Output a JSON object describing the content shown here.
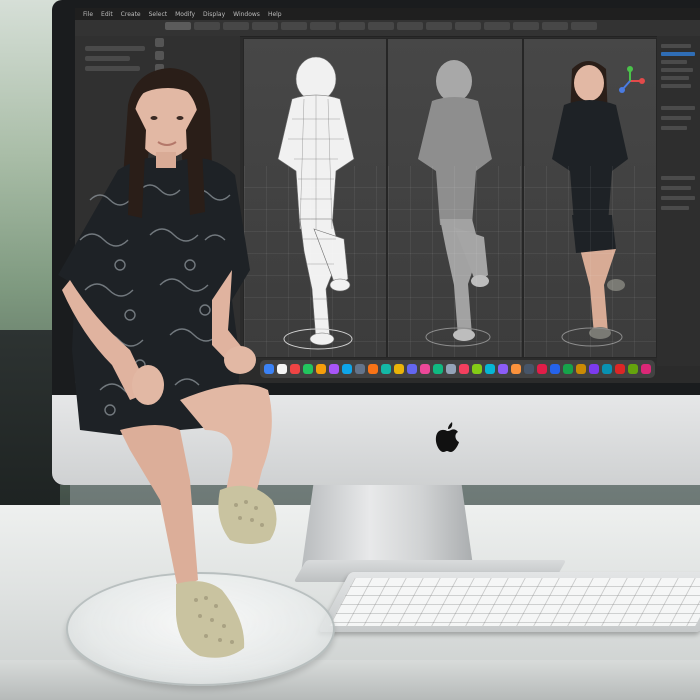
{
  "scene": {
    "description_elements": [
      "monitor",
      "screen",
      "keyboard",
      "figurine",
      "acrylic-base",
      "desk"
    ]
  },
  "screen": {
    "menubar_items": [
      "File",
      "Edit",
      "Create",
      "Select",
      "Modify",
      "Display",
      "Windows",
      "Help"
    ],
    "viewports": [
      "wireframe",
      "clay",
      "textured"
    ]
  },
  "colors": {
    "desk": "#e6e8e7",
    "screen_bg": "#2b2b2b",
    "viewport_bg": "#444444",
    "dress": "#1e2226",
    "shoes": "#c9c3a0",
    "skin": "#e2b8a4",
    "hair": "#2a1e18"
  },
  "dock": {
    "icon_colors": [
      "#3b82f6",
      "#f5f5f5",
      "#ef4444",
      "#22c55e",
      "#f59e0b",
      "#a855f7",
      "#0ea5e9",
      "#64748b",
      "#f97316",
      "#14b8a6",
      "#eab308",
      "#6366f1",
      "#ec4899",
      "#10b981",
      "#94a3b8",
      "#f43f5e",
      "#84cc16",
      "#06b6d4",
      "#8b5cf6",
      "#fb923c",
      "#475569",
      "#e11d48",
      "#2563eb",
      "#16a34a",
      "#ca8a04",
      "#7c3aed",
      "#0891b2",
      "#dc2626",
      "#65a30d",
      "#db2777"
    ]
  }
}
